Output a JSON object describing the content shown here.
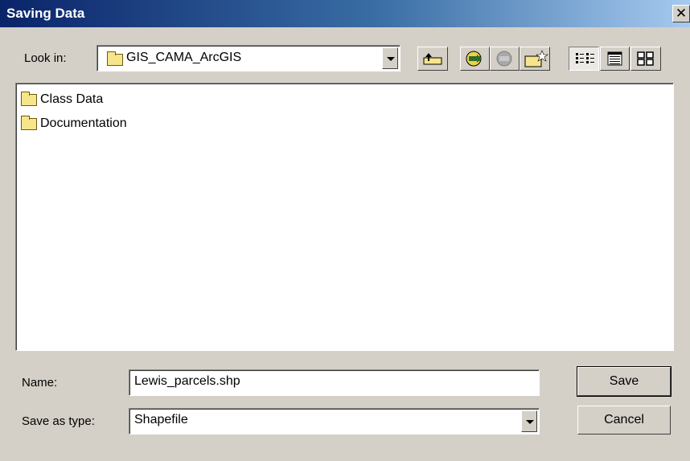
{
  "window": {
    "title": "Saving Data",
    "close_glyph": "✕"
  },
  "look_in": {
    "label": "Look in:",
    "value": "GIS_CAMA_ArcGIS"
  },
  "toolbar": {
    "buttons": [
      "up-one-level-icon",
      "connect-to-folder-icon",
      "disconnect-folder-icon",
      "new-folder-icon",
      "list-view-icon",
      "details-view-icon",
      "thumbnails-view-icon"
    ]
  },
  "file_list": {
    "items": [
      {
        "label": "Class Data"
      },
      {
        "label": "Documentation"
      }
    ]
  },
  "name_field": {
    "label": "Name:",
    "value": "Lewis_parcels.shp"
  },
  "type_field": {
    "label": "Save as type:",
    "value": "Shapefile"
  },
  "actions": {
    "save_label": "Save",
    "cancel_label": "Cancel"
  }
}
